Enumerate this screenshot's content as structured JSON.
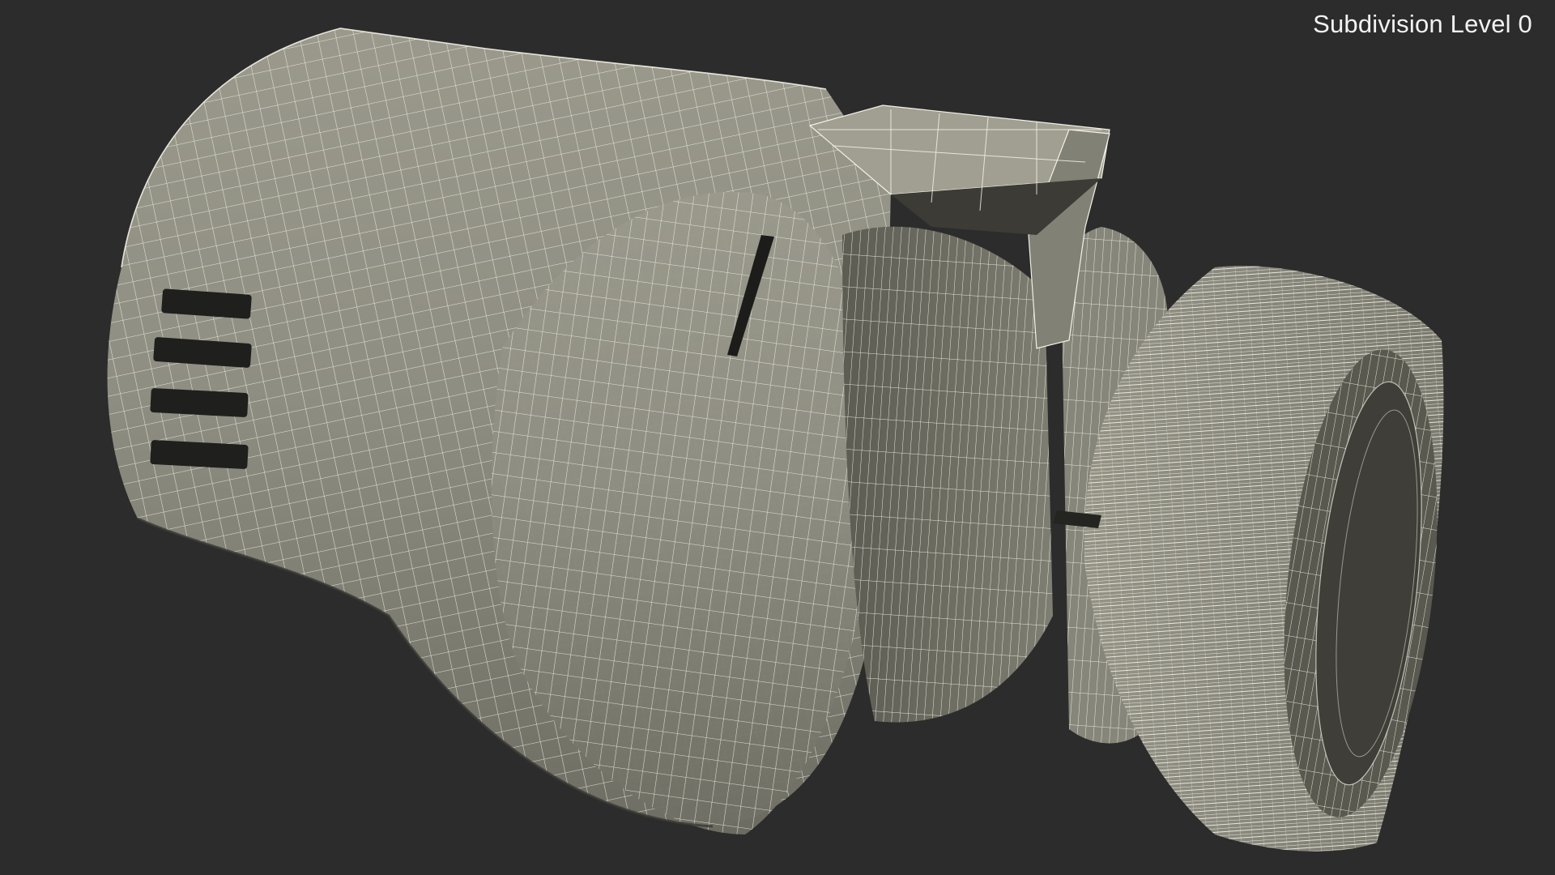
{
  "viewport": {
    "overlay_label": "Subdivision Level 0",
    "background_color": "#2c2c2c",
    "mesh_color": "#8c8b7f",
    "wire_color": "#f4f2e6",
    "shadow_color": "#3a3a36"
  },
  "scene": {
    "subject": "thermostatic-radiator-valve-head-wireframe"
  }
}
